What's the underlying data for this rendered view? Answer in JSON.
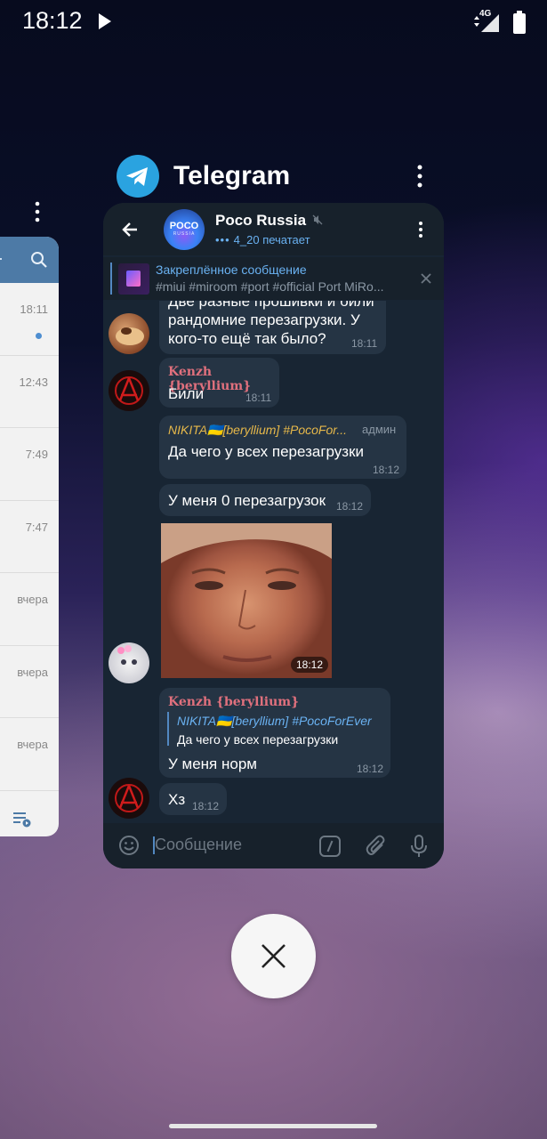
{
  "status_bar": {
    "time": "18:12",
    "network": "4G"
  },
  "recents": {
    "app_name": "Telegram",
    "left_card_times": [
      "18:11",
      "12:43",
      "7:49",
      "7:47",
      "вчера",
      "вчера",
      "вчера"
    ]
  },
  "chat": {
    "name": "Poco Russia",
    "avatar_text": "POCO",
    "avatar_subtext": "RUSSIA",
    "typing": "4_20 печатает",
    "pinned": {
      "title": "Закреплённое сообщение",
      "text": "#miui #miroom #port #official Port MiRo..."
    },
    "messages": [
      {
        "text": "Две разные прошивки и били рандомние перезагрузки. У кого-то ещё так было?",
        "time": "18:11"
      },
      {
        "sender": "Kenzh {beryllium}",
        "text": "Били",
        "time": "18:11"
      },
      {
        "sender": "NIKITA🇺🇦[beryllium] #PocoFor...",
        "badge": "админ",
        "text": "Да чего у всех перезагрузки",
        "time": "18:12"
      },
      {
        "text": "У меня 0 перезагрузок",
        "time": "18:12"
      },
      {
        "photo_time": "18:12"
      },
      {
        "sender": "Kenzh {beryllium}",
        "reply_name": "NIKITA🇺🇦[beryllium] #PocoForEver",
        "reply_text": "Да чего у всех перезагрузки",
        "text": "У меня норм",
        "time": "18:12"
      },
      {
        "text": "Хз",
        "time": "18:12"
      }
    ],
    "input_placeholder": "Сообщение"
  },
  "colors": {
    "background": "#182533",
    "bubble": "#253444",
    "accent": "#6ab2f2",
    "admin_name": "#e6b84a",
    "user_name": "#e0707d"
  }
}
